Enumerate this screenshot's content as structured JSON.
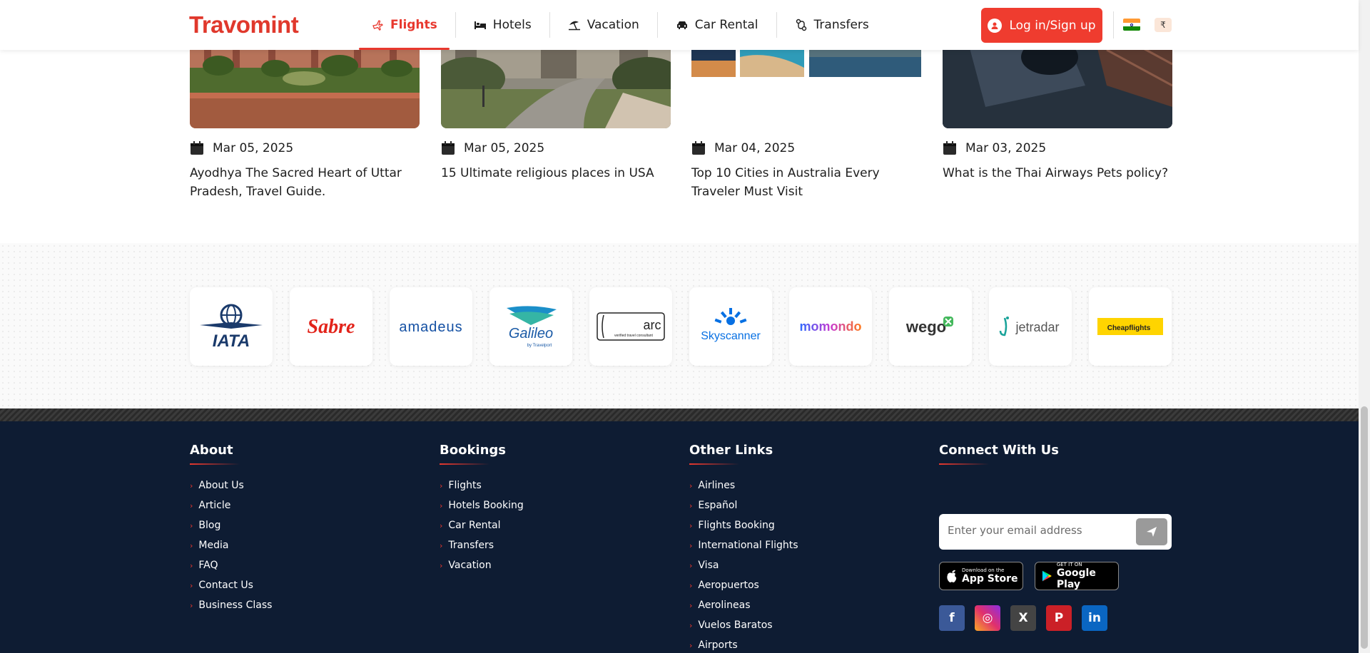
{
  "header": {
    "logo": "Travomint",
    "nav": [
      {
        "label": "Flights",
        "icon": "airplane-icon",
        "active": true
      },
      {
        "label": "Hotels",
        "icon": "bed-icon",
        "active": false
      },
      {
        "label": "Vacation",
        "icon": "beach-umbrella-icon",
        "active": false
      },
      {
        "label": "Car Rental",
        "icon": "car-icon",
        "active": false
      },
      {
        "label": "Transfers",
        "icon": "route-icon",
        "active": false
      }
    ],
    "login_label": "Log in/Sign up",
    "currency": "₹",
    "accent": "#ef3c2f"
  },
  "blog": [
    {
      "date": "Mar 05, 2025",
      "title": "Ayodhya The Sacred Heart of Uttar Pradesh, Travel Guide."
    },
    {
      "date": "Mar 05, 2025",
      "title": "15 Ultimate religious places in USA"
    },
    {
      "date": "Mar 04, 2025",
      "title": "Top 10 Cities in Australia Every Traveler Must Visit"
    },
    {
      "date": "Mar 03, 2025",
      "title": "What is the Thai Airways Pets policy?"
    }
  ],
  "partners": [
    "IATA",
    "Sabre",
    "amadeus",
    "Galileo",
    "arc",
    "Skyscanner",
    "momondo",
    "wego",
    "jetradar",
    "Cheapflights"
  ],
  "partner_sub": {
    "galileo": "by Travelport",
    "arc": "verified travel consultant"
  },
  "footer": {
    "about": {
      "heading": "About",
      "links": [
        "About Us",
        "Article",
        "Blog",
        "Media",
        "FAQ",
        "Contact Us",
        "Business Class"
      ]
    },
    "bookings": {
      "heading": "Bookings",
      "links": [
        "Flights",
        "Hotels Booking",
        "Car Rental",
        "Transfers",
        "Vacation"
      ]
    },
    "other": {
      "heading": "Other Links",
      "links": [
        "Airlines",
        "Español",
        "Flights Booking",
        "International Flights",
        "Visa",
        "Aeropuertos",
        "Aerolineas",
        "Vuelos Baratos",
        "Airports"
      ]
    },
    "connect": {
      "heading": "Connect With Us",
      "email_placeholder": "Enter your email address",
      "app_store_small": "Download on the",
      "app_store_big": "App Store",
      "play_small": "GET IT ON",
      "play_big": "Google Play",
      "socials": [
        {
          "name": "facebook-icon",
          "glyph": "f",
          "color": "#3b5998"
        },
        {
          "name": "instagram-icon",
          "glyph": "◎",
          "color": "#e1306c"
        },
        {
          "name": "x-twitter-icon",
          "glyph": "X",
          "color": "#444444"
        },
        {
          "name": "pinterest-icon",
          "glyph": "P",
          "color": "#cb2027"
        },
        {
          "name": "linkedin-icon",
          "glyph": "in",
          "color": "#0a66c2"
        }
      ]
    }
  }
}
